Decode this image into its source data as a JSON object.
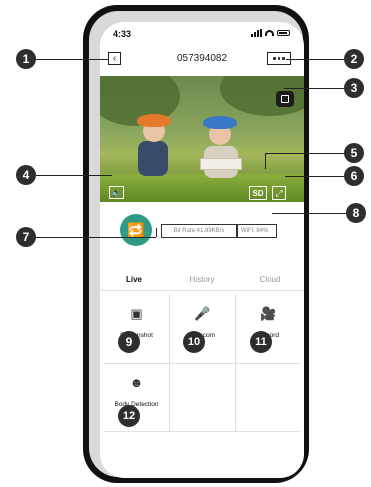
{
  "status_bar": {
    "time": "4:33"
  },
  "header": {
    "title": "057394082",
    "back_icon": "chevron-left-icon",
    "more_icon": "ellipsis-icon"
  },
  "video": {
    "sd_label": "SD",
    "speaker_icon": "speaker-icon",
    "fullscreen_icon": "expand-icon",
    "record_status_icon": "camera-status-icon"
  },
  "info": {
    "bitrate": "Bit Rate:41.99KB/s",
    "wifi": "WiFi: 84%",
    "device_icon": "camera-link-icon"
  },
  "tabs": [
    {
      "label": "Live"
    },
    {
      "label": "History"
    },
    {
      "label": "Cloud"
    }
  ],
  "actions": [
    {
      "label": "Screenshot",
      "icon": "screenshot-icon"
    },
    {
      "label": "Intercom",
      "icon": "microphone-icon"
    },
    {
      "label": "Record",
      "icon": "video-record-icon"
    },
    {
      "label": "Body Detection",
      "icon": "body-detection-icon"
    }
  ],
  "callouts": [
    "1",
    "2",
    "3",
    "4",
    "5",
    "6",
    "7",
    "8",
    "9",
    "10",
    "11",
    "12"
  ],
  "colors": {
    "accent": "#2e9a87",
    "badge": "#2e2e2e"
  }
}
